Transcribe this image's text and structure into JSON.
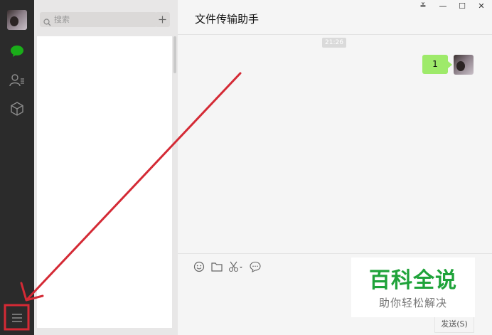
{
  "chat": {
    "title": "文件传输助手",
    "time": "21:26",
    "message": "1",
    "send_label": "发送(S)"
  },
  "search": {
    "placeholder": "搜索"
  },
  "window_controls": [
    "≚",
    "—",
    "☐",
    "✕"
  ],
  "watermark": {
    "main": "百科全说",
    "sub": "助你轻松解决"
  },
  "icons": {
    "chat": "chat-bubble-icon",
    "contacts": "contacts-icon",
    "favorites": "cube-icon",
    "menu": "menu-icon",
    "emoji": "emoji-icon",
    "folder": "folder-icon",
    "screenshot": "scissors-icon",
    "history": "chat-history-icon"
  },
  "colors": {
    "accent_green": "#1aad19",
    "bubble_green": "#9eea6a",
    "annotation_red": "#d42a35"
  }
}
